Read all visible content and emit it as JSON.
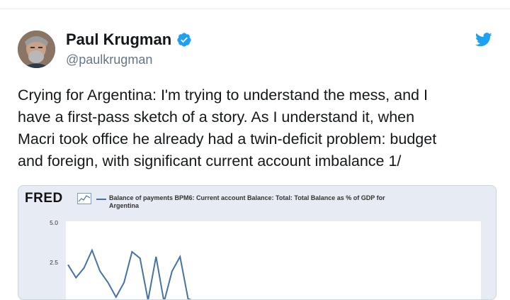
{
  "tweet": {
    "author_name": "Paul Krugman",
    "handle": "@paulkrugman",
    "text_lines": [
      "Crying for Argentina: I'm trying to understand the mess, and I",
      "have a first-pass sketch of a story. As I understand it, when",
      "Macri took office he already had a twin-deficit problem: budget",
      "and foreign, with significant current account imbalance 1/"
    ]
  },
  "icons": {
    "avatar": "avatar-photo",
    "verified": "verified-badge-icon",
    "bird": "twitter-bird-icon"
  },
  "colors": {
    "accent": "#1da1f2",
    "series": "#4572a7"
  },
  "chart": {
    "logo_text": "FRED",
    "legend_line1": "Balance of payments BPM6: Current account Balance: Total: Total Balance as % of GDP for",
    "legend_line2": "Argentina",
    "y_ticks": [
      "5.0",
      "2.5"
    ]
  },
  "chart_data": {
    "type": "line",
    "title": "",
    "xlabel": "",
    "ylabel": "",
    "ylim": [
      -1.5,
      5.0
    ],
    "series": [
      {
        "name": "Balance of payments BPM6: Current account Balance: Total: Total Balance as % of GDP for Argentina",
        "values": [
          2.4,
          1.6,
          2.2,
          3.3,
          2.0,
          1.3,
          0.4,
          1.3,
          3.2,
          2.8,
          0.2,
          2.9,
          0.1,
          2.0,
          2.9,
          0.3,
          0.1
        ]
      }
    ]
  }
}
